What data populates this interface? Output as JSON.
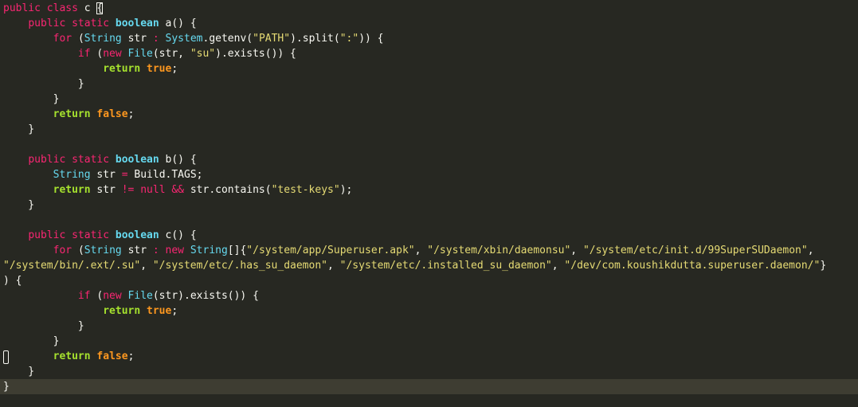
{
  "editor": {
    "language": "java",
    "theme_colors": {
      "background": "#272822",
      "current_line": "#3e3d32",
      "keyword": "#f92672",
      "type": "#66d9ef",
      "string": "#e6db74",
      "return_keyword": "#a6e22e",
      "literal": "#fd971f",
      "text": "#f8f8f2"
    },
    "lines": [
      [
        [
          "kw",
          "public class "
        ],
        [
          "plain",
          "c "
        ],
        [
          "match",
          "{"
        ]
      ],
      [
        [
          "plain",
          "    "
        ],
        [
          "kw",
          "public static "
        ],
        [
          "prim",
          "boolean "
        ],
        [
          "plain",
          "a() {"
        ]
      ],
      [
        [
          "plain",
          "        "
        ],
        [
          "kw",
          "for "
        ],
        [
          "plain",
          "("
        ],
        [
          "type",
          "String "
        ],
        [
          "plain",
          "str "
        ],
        [
          "op",
          ": "
        ],
        [
          "type",
          "System"
        ],
        [
          "plain",
          ".getenv("
        ],
        [
          "str",
          "\"PATH\""
        ],
        [
          "plain",
          ").split("
        ],
        [
          "str",
          "\":\""
        ],
        [
          "plain",
          ")) {"
        ]
      ],
      [
        [
          "plain",
          "            "
        ],
        [
          "kw",
          "if "
        ],
        [
          "plain",
          "("
        ],
        [
          "kw",
          "new "
        ],
        [
          "type",
          "File"
        ],
        [
          "plain",
          "(str, "
        ],
        [
          "str",
          "\"su\""
        ],
        [
          "plain",
          ").exists()) {"
        ]
      ],
      [
        [
          "plain",
          "                "
        ],
        [
          "ret",
          "return "
        ],
        [
          "lit",
          "true"
        ],
        [
          "plain",
          ";"
        ]
      ],
      [
        [
          "plain",
          "            }"
        ]
      ],
      [
        [
          "plain",
          "        }"
        ]
      ],
      [
        [
          "plain",
          "        "
        ],
        [
          "ret",
          "return "
        ],
        [
          "lit",
          "false"
        ],
        [
          "plain",
          ";"
        ]
      ],
      [
        [
          "plain",
          "    }"
        ]
      ],
      [
        [
          "plain",
          ""
        ]
      ],
      [
        [
          "plain",
          "    "
        ],
        [
          "kw",
          "public static "
        ],
        [
          "prim",
          "boolean "
        ],
        [
          "plain",
          "b() {"
        ]
      ],
      [
        [
          "plain",
          "        "
        ],
        [
          "type",
          "String "
        ],
        [
          "plain",
          "str "
        ],
        [
          "op",
          "= "
        ],
        [
          "plain",
          "Build.TAGS;"
        ]
      ],
      [
        [
          "plain",
          "        "
        ],
        [
          "ret",
          "return "
        ],
        [
          "plain",
          "str "
        ],
        [
          "op",
          "!= "
        ],
        [
          "kw",
          "null "
        ],
        [
          "op",
          "&& "
        ],
        [
          "plain",
          "str.contains("
        ],
        [
          "str",
          "\"test-keys\""
        ],
        [
          "plain",
          ");"
        ]
      ],
      [
        [
          "plain",
          "    }"
        ]
      ],
      [
        [
          "plain",
          ""
        ]
      ],
      [
        [
          "plain",
          "    "
        ],
        [
          "kw",
          "public static "
        ],
        [
          "prim",
          "boolean "
        ],
        [
          "plain",
          "c() {"
        ]
      ],
      [
        [
          "plain",
          "        "
        ],
        [
          "kw",
          "for "
        ],
        [
          "plain",
          "("
        ],
        [
          "type",
          "String "
        ],
        [
          "plain",
          "str "
        ],
        [
          "op",
          ": "
        ],
        [
          "kw",
          "new "
        ],
        [
          "type",
          "String"
        ],
        [
          "plain",
          "[]{"
        ],
        [
          "str",
          "\"/system/app/Superuser.apk\""
        ],
        [
          "plain",
          ", "
        ],
        [
          "str",
          "\"/system/xbin/daemonsu\""
        ],
        [
          "plain",
          ", "
        ],
        [
          "str",
          "\"/system/etc/init.d/99SuperSUDaemon\""
        ],
        [
          "plain",
          ","
        ]
      ],
      [
        [
          "str",
          "\"/system/bin/.ext/.su\""
        ],
        [
          "plain",
          ", "
        ],
        [
          "str",
          "\"/system/etc/.has_su_daemon\""
        ],
        [
          "plain",
          ", "
        ],
        [
          "str",
          "\"/system/etc/.installed_su_daemon\""
        ],
        [
          "plain",
          ", "
        ],
        [
          "str",
          "\"/dev/com.koushikdutta.superuser.daemon/\""
        ],
        [
          "plain",
          "}"
        ]
      ],
      [
        [
          "plain",
          ") {"
        ]
      ],
      [
        [
          "plain",
          "            "
        ],
        [
          "kw",
          "if "
        ],
        [
          "plain",
          "("
        ],
        [
          "kw",
          "new "
        ],
        [
          "type",
          "File"
        ],
        [
          "plain",
          "(str).exists()) {"
        ]
      ],
      [
        [
          "plain",
          "                "
        ],
        [
          "ret",
          "return "
        ],
        [
          "lit",
          "true"
        ],
        [
          "plain",
          ";"
        ]
      ],
      [
        [
          "plain",
          "            }"
        ]
      ],
      [
        [
          "plain",
          "        }"
        ]
      ],
      [
        [
          "plain",
          "        "
        ],
        [
          "ret",
          "return "
        ],
        [
          "lit",
          "false"
        ],
        [
          "plain",
          ";"
        ]
      ],
      [
        [
          "plain",
          "    }"
        ]
      ],
      [
        [
          "plain",
          "}"
        ]
      ]
    ],
    "current_line_index": 25
  }
}
